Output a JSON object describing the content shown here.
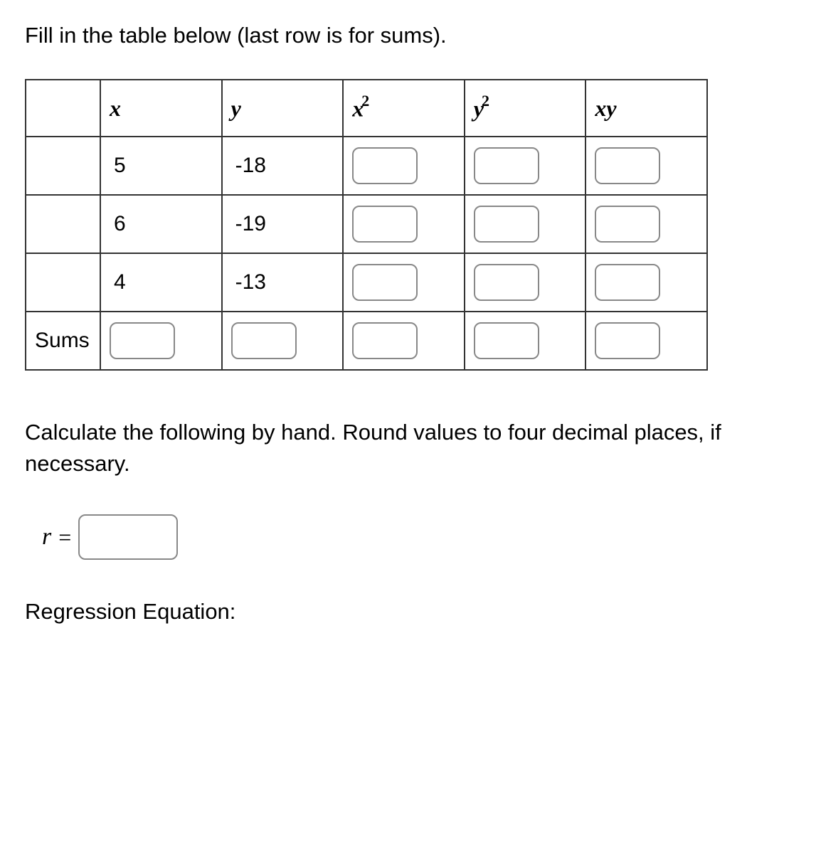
{
  "instruction1": "Fill in the table below (last row is for sums).",
  "instruction2": "Calculate the following by hand. Round values to four decimal places, if necessary.",
  "table": {
    "headers": {
      "col0": "",
      "col1_var": "x",
      "col2_var": "y",
      "col3_var": "x",
      "col3_sup": "2",
      "col4_var": "y",
      "col4_sup": "2",
      "col5_varA": "x",
      "col5_varB": "y"
    },
    "rows": [
      {
        "label": "",
        "x": "5",
        "y": "-18",
        "x2": "",
        "y2": "",
        "xy": ""
      },
      {
        "label": "",
        "x": "6",
        "y": "-19",
        "x2": "",
        "y2": "",
        "xy": ""
      },
      {
        "label": "",
        "x": "4",
        "y": "-13",
        "x2": "",
        "y2": "",
        "xy": ""
      }
    ],
    "sums_label": "Sums",
    "sums": {
      "x": "",
      "y": "",
      "x2": "",
      "y2": "",
      "xy": ""
    }
  },
  "r_label": "r",
  "r_eq": "=",
  "r_value": "",
  "regression_label": "Regression Equation:"
}
